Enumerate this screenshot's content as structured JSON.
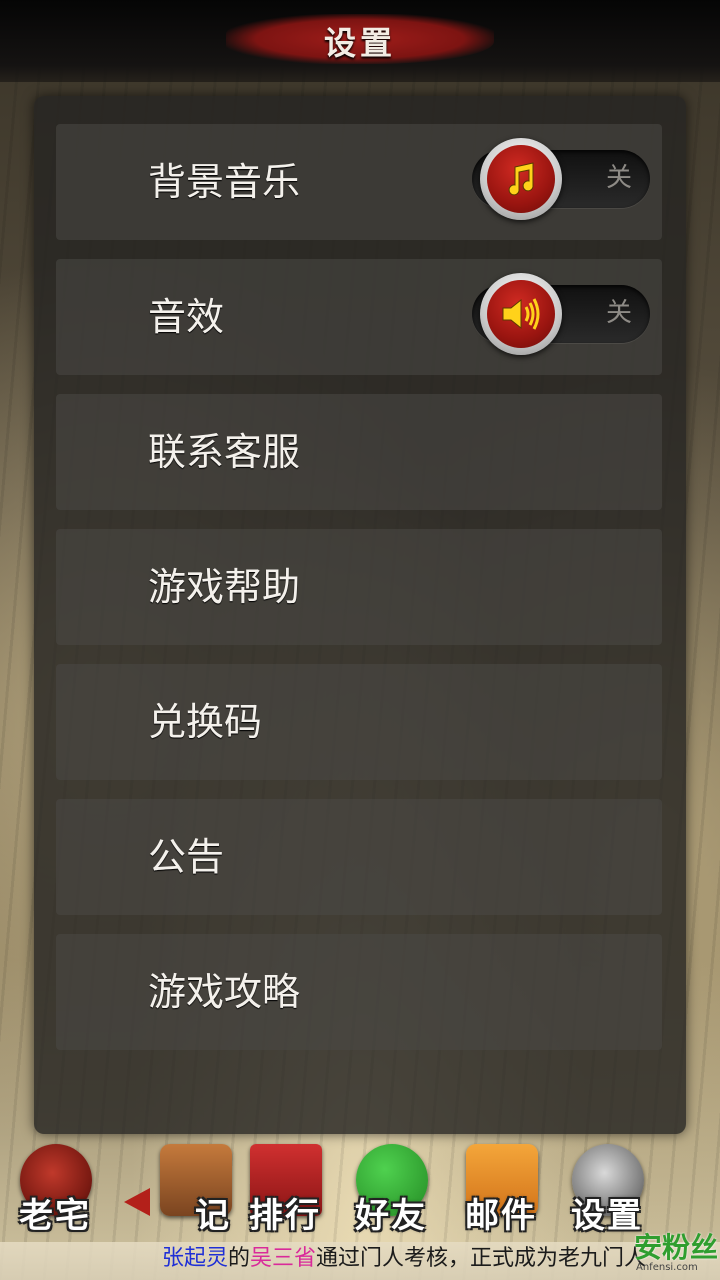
{
  "header": {
    "title": "设置"
  },
  "settings": {
    "bg_music": {
      "label": "背景音乐",
      "toggle_state": "关",
      "icon": "music-note-icon"
    },
    "sound_effects": {
      "label": "音效",
      "toggle_state": "关",
      "icon": "speaker-icon"
    },
    "items": [
      {
        "label": "联系客服"
      },
      {
        "label": "游戏帮助"
      },
      {
        "label": "兑换码"
      },
      {
        "label": "公告"
      },
      {
        "label": "游戏攻略"
      }
    ]
  },
  "nav": {
    "items": [
      {
        "label": "老宅",
        "icon": "gate-icon"
      },
      {
        "label": "记",
        "icon": "character-icon"
      },
      {
        "label": "排行",
        "icon": "podium-icon"
      },
      {
        "label": "好友",
        "icon": "chat-bubble-icon"
      },
      {
        "label": "邮件",
        "icon": "envelope-icon"
      },
      {
        "label": "设置",
        "icon": "gear-icon"
      }
    ]
  },
  "marquee": {
    "name1": "张起灵",
    "middle1": "的",
    "name2": "吴三省",
    "rest": "通过门人考核，正式成为老九门人"
  },
  "watermark": {
    "text": "安粉丝",
    "sub": "Anfensi.com"
  },
  "colors": {
    "accent_red": "#9a1510",
    "panel": "#262422",
    "row": "#4a4846",
    "marquee_blue": "#1f2fd6",
    "marquee_pink": "#d92a9a"
  }
}
